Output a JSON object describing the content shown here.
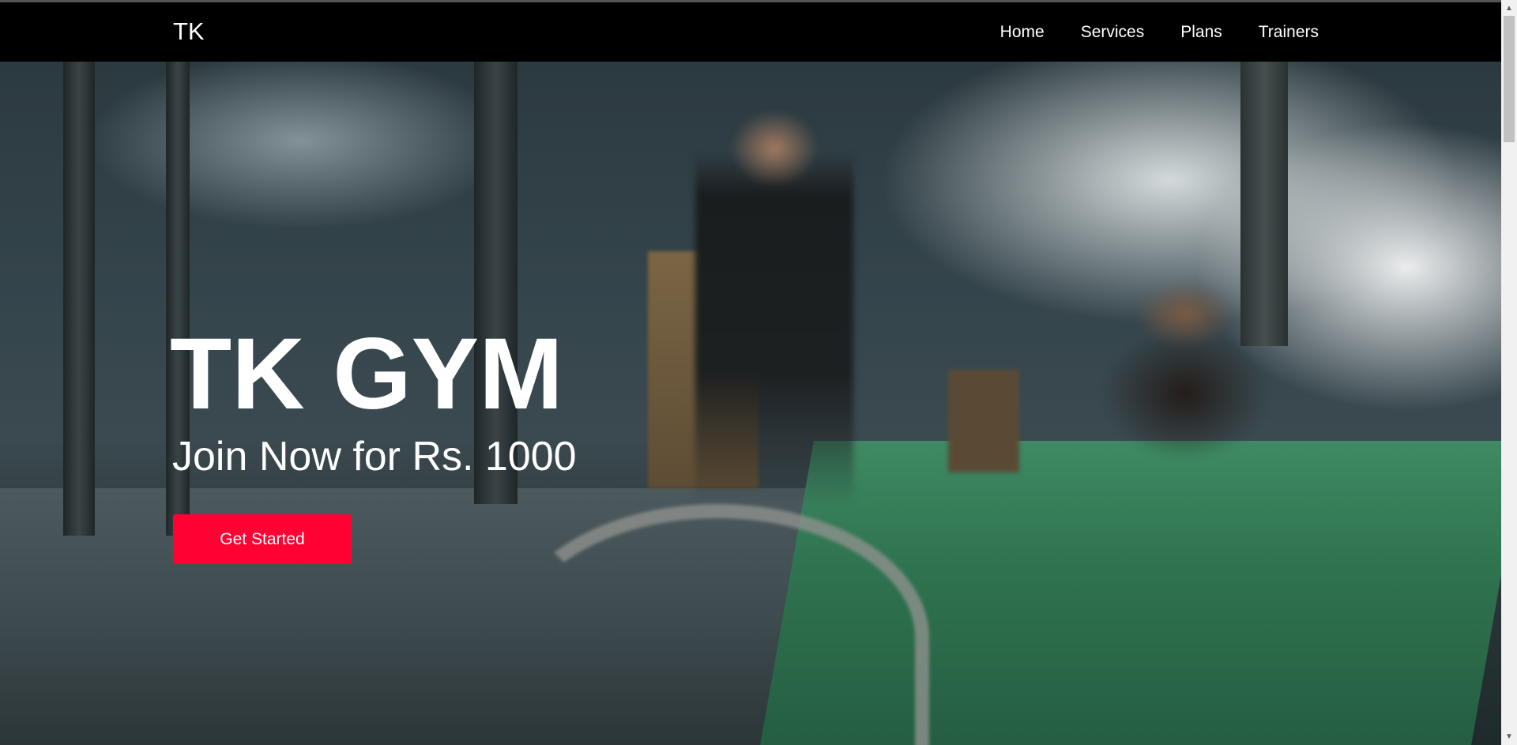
{
  "navbar": {
    "brand": "TK",
    "links": [
      "Home",
      "Services",
      "Plans",
      "Trainers"
    ]
  },
  "hero": {
    "title": "TK GYM",
    "subtitle": "Join Now for Rs. 1000",
    "cta_label": "Get Started"
  },
  "colors": {
    "navbar_bg": "#000000",
    "cta_bg": "#ff0133",
    "text": "#ffffff"
  },
  "icons": {
    "scroll_up": "▲",
    "scroll_down": "▼"
  }
}
